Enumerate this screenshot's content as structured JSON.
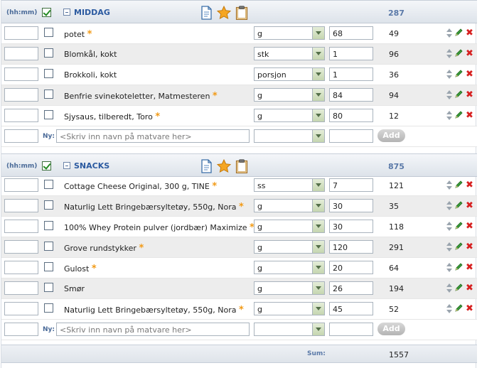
{
  "common": {
    "time_label": "(hh:mm)",
    "new_label": "Ny:",
    "new_placeholder": "<Skriv inn navn på matvare her>",
    "add_label": "Add",
    "star": "*"
  },
  "meals": [
    {
      "name": "MIDDAG",
      "total": "287",
      "items": [
        {
          "food": "potet",
          "starred": true,
          "unit": "g",
          "amount": "68",
          "kcal": "49"
        },
        {
          "food": "Blomkål, kokt",
          "starred": false,
          "unit": "stk",
          "amount": "1",
          "kcal": "96"
        },
        {
          "food": "Brokkoli, kokt",
          "starred": false,
          "unit": "porsjon",
          "amount": "1",
          "kcal": "36"
        },
        {
          "food": "Benfrie svinekoteletter, Matmesteren",
          "starred": true,
          "unit": "g",
          "amount": "84",
          "kcal": "94"
        },
        {
          "food": "Sjysaus, tilberedt, Toro",
          "starred": true,
          "unit": "g",
          "amount": "80",
          "kcal": "12"
        }
      ]
    },
    {
      "name": "SNACKS",
      "total": "875",
      "items": [
        {
          "food": "Cottage Cheese Original, 300 g, TINE",
          "starred": true,
          "unit": "ss",
          "amount": "7",
          "kcal": "121"
        },
        {
          "food": "Naturlig Lett Bringebærsyltetøy, 550g, Nora",
          "starred": true,
          "unit": "g",
          "amount": "30",
          "kcal": "35"
        },
        {
          "food": "100% Whey Protein pulver (jordbær) Maximize",
          "starred": true,
          "unit": "g",
          "amount": "30",
          "kcal": "118"
        },
        {
          "food": "Grove rundstykker",
          "starred": true,
          "unit": "g",
          "amount": "120",
          "kcal": "291"
        },
        {
          "food": "Gulost",
          "starred": true,
          "unit": "g",
          "amount": "20",
          "kcal": "64"
        },
        {
          "food": "Smør",
          "starred": false,
          "unit": "g",
          "amount": "26",
          "kcal": "194"
        },
        {
          "food": "Naturlig Lett Bringebærsyltetøy, 550g, Nora",
          "starred": true,
          "unit": "g",
          "amount": "45",
          "kcal": "52"
        }
      ]
    }
  ],
  "summary": {
    "label": "Sum:",
    "value": "1557"
  },
  "colors": {
    "accent": "#2b5aa0",
    "star": "#f29a16",
    "delete": "#d62020",
    "edit": "#2d8a2d"
  }
}
